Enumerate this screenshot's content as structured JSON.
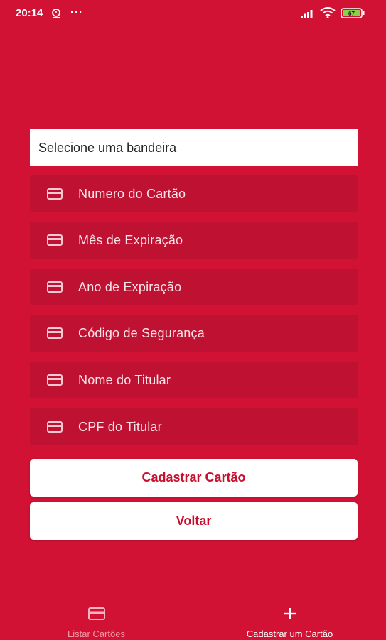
{
  "status_bar": {
    "time": "20:14",
    "dots": "···",
    "battery": "67"
  },
  "form": {
    "select_placeholder": "Selecione uma bandeira",
    "fields": [
      {
        "label": "Numero do Cartão",
        "icon": "card-icon"
      },
      {
        "label": "Mês de Expiração",
        "icon": "card-icon"
      },
      {
        "label": "Ano de Expiração",
        "icon": "card-icon"
      },
      {
        "label": "Código de Segurança",
        "icon": "card-icon"
      },
      {
        "label": "Nome do Titular",
        "icon": "card-icon"
      },
      {
        "label": "CPF do Titular",
        "icon": "card-icon"
      }
    ],
    "save_label": "Cadastrar Cartão",
    "back_label": "Voltar"
  },
  "tabbar": {
    "tabs": [
      {
        "label": "Listar Cartões",
        "icon": "card-icon",
        "active": false
      },
      {
        "label": "Cadastrar um Cartão",
        "icon": "plus-icon",
        "active": true
      }
    ]
  },
  "colors": {
    "background": "#d21234",
    "field": "#bf1131",
    "button_text": "#c8102e",
    "inactive_tab": "#f39aaa"
  }
}
